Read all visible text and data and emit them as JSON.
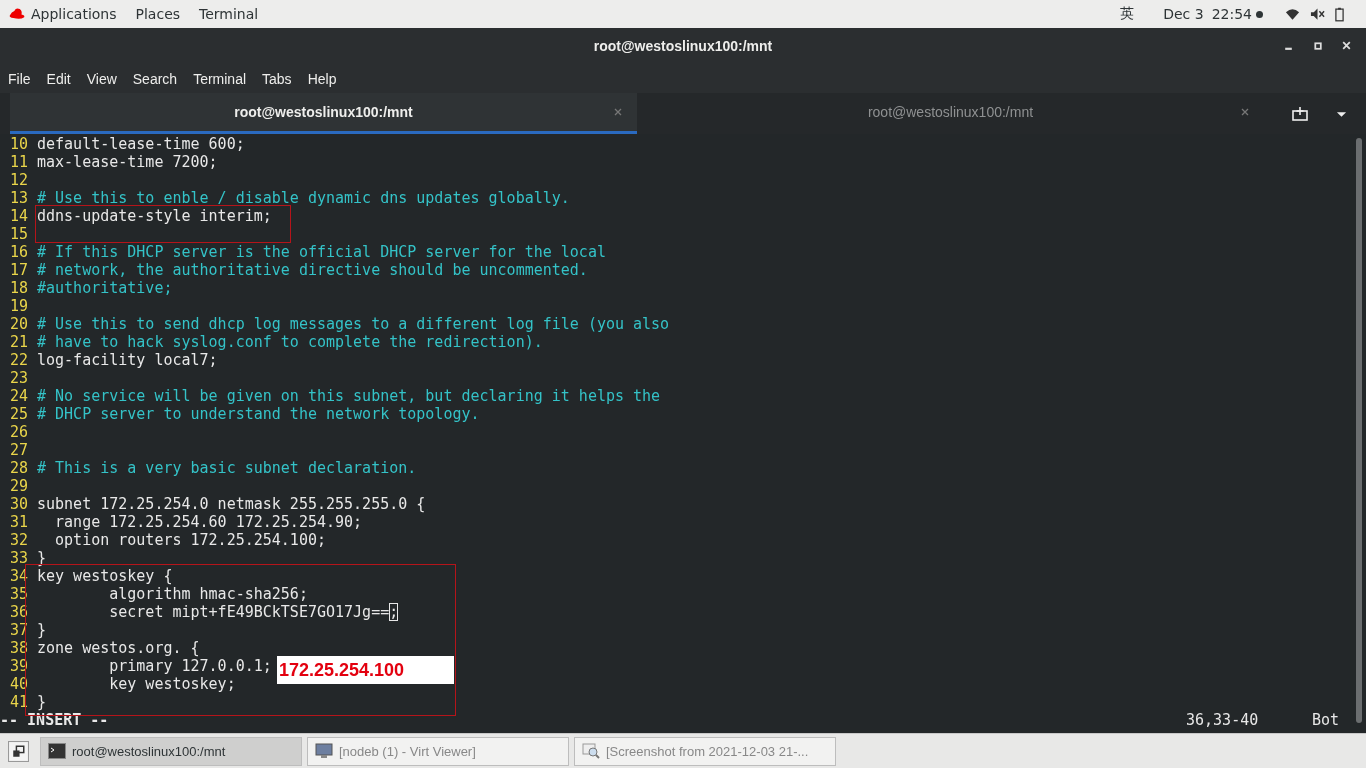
{
  "top_bar": {
    "menus": [
      "Applications",
      "Places",
      "Terminal"
    ],
    "input_method": "英",
    "date": "Dec 3",
    "time": "22:54"
  },
  "window": {
    "title": "root@westoslinux100:/mnt"
  },
  "menu_bar": [
    "File",
    "Edit",
    "View",
    "Search",
    "Terminal",
    "Tabs",
    "Help"
  ],
  "tabs": [
    {
      "label": "root@westoslinux100:/mnt",
      "selected": true
    },
    {
      "label": "root@westoslinux100:/mnt",
      "selected": false
    }
  ],
  "editor": {
    "lines": [
      {
        "num": "10",
        "kind": "code",
        "text": "default-lease-time 600;"
      },
      {
        "num": "11",
        "kind": "code",
        "text": "max-lease-time 7200;"
      },
      {
        "num": "12"
      },
      {
        "num": "13",
        "kind": "comment",
        "text": "# Use this to enble / disable dynamic dns updates globally."
      },
      {
        "num": "14",
        "kind": "code",
        "text": "ddns-update-style interim;"
      },
      {
        "num": "15"
      },
      {
        "num": "16",
        "kind": "comment",
        "text": "# If this DHCP server is the official DHCP server for the local"
      },
      {
        "num": "17",
        "kind": "comment",
        "text": "# network, the authoritative directive should be uncommented."
      },
      {
        "num": "18",
        "kind": "comment",
        "text": "#authoritative;"
      },
      {
        "num": "19"
      },
      {
        "num": "20",
        "kind": "comment",
        "text": "# Use this to send dhcp log messages to a different log file (you also"
      },
      {
        "num": "21",
        "kind": "comment",
        "text": "# have to hack syslog.conf to complete the redirection)."
      },
      {
        "num": "22",
        "kind": "code",
        "text": "log-facility local7;"
      },
      {
        "num": "23"
      },
      {
        "num": "24",
        "kind": "comment",
        "text": "# No service will be given on this subnet, but declaring it helps the"
      },
      {
        "num": "25",
        "kind": "comment",
        "text": "# DHCP server to understand the network topology."
      },
      {
        "num": "26"
      },
      {
        "num": "27"
      },
      {
        "num": "28",
        "kind": "comment",
        "text": "# This is a very basic subnet declaration."
      },
      {
        "num": "29"
      },
      {
        "num": "30",
        "kind": "code",
        "text": "subnet 172.25.254.0 netmask 255.255.255.0 {"
      },
      {
        "num": "31",
        "kind": "code",
        "text": "  range 172.25.254.60 172.25.254.90;"
      },
      {
        "num": "32",
        "kind": "code",
        "text": "  option routers 172.25.254.100;"
      },
      {
        "num": "33",
        "kind": "code",
        "text": "}"
      },
      {
        "num": "34",
        "kind": "code",
        "text": "key westoskey {"
      },
      {
        "num": "35",
        "kind": "code",
        "text": "        algorithm hmac-sha256;"
      },
      {
        "num": "36",
        "kind": "code",
        "text": "        secret mipt+fE49BCkTSE7GO17Jg==",
        "cursor": ";"
      },
      {
        "num": "37",
        "kind": "code",
        "text": "}"
      },
      {
        "num": "38",
        "kind": "code",
        "text": "zone westos.org. {"
      },
      {
        "num": "39",
        "kind": "code",
        "text": "        primary 127.0.0.1;"
      },
      {
        "num": "40",
        "kind": "code",
        "text": "        key westoskey;"
      },
      {
        "num": "41",
        "kind": "code",
        "text": "}"
      }
    ],
    "mode": "-- INSERT --",
    "position": "36,33-40",
    "scroll": "Bot"
  },
  "annotations": [
    {
      "kind": "box"
    },
    {
      "kind": "box"
    },
    {
      "kind": "label",
      "text": "172.25.254.100"
    }
  ],
  "taskbar": [
    {
      "kind": "terminal",
      "label": "root@westoslinux100:/mnt",
      "selected": true
    },
    {
      "kind": "viewer",
      "label": "[nodeb (1) - Virt Viewer]",
      "selected": false
    },
    {
      "kind": "image",
      "label": "[Screenshot from 2021-12-03 21-...",
      "selected": false
    }
  ]
}
